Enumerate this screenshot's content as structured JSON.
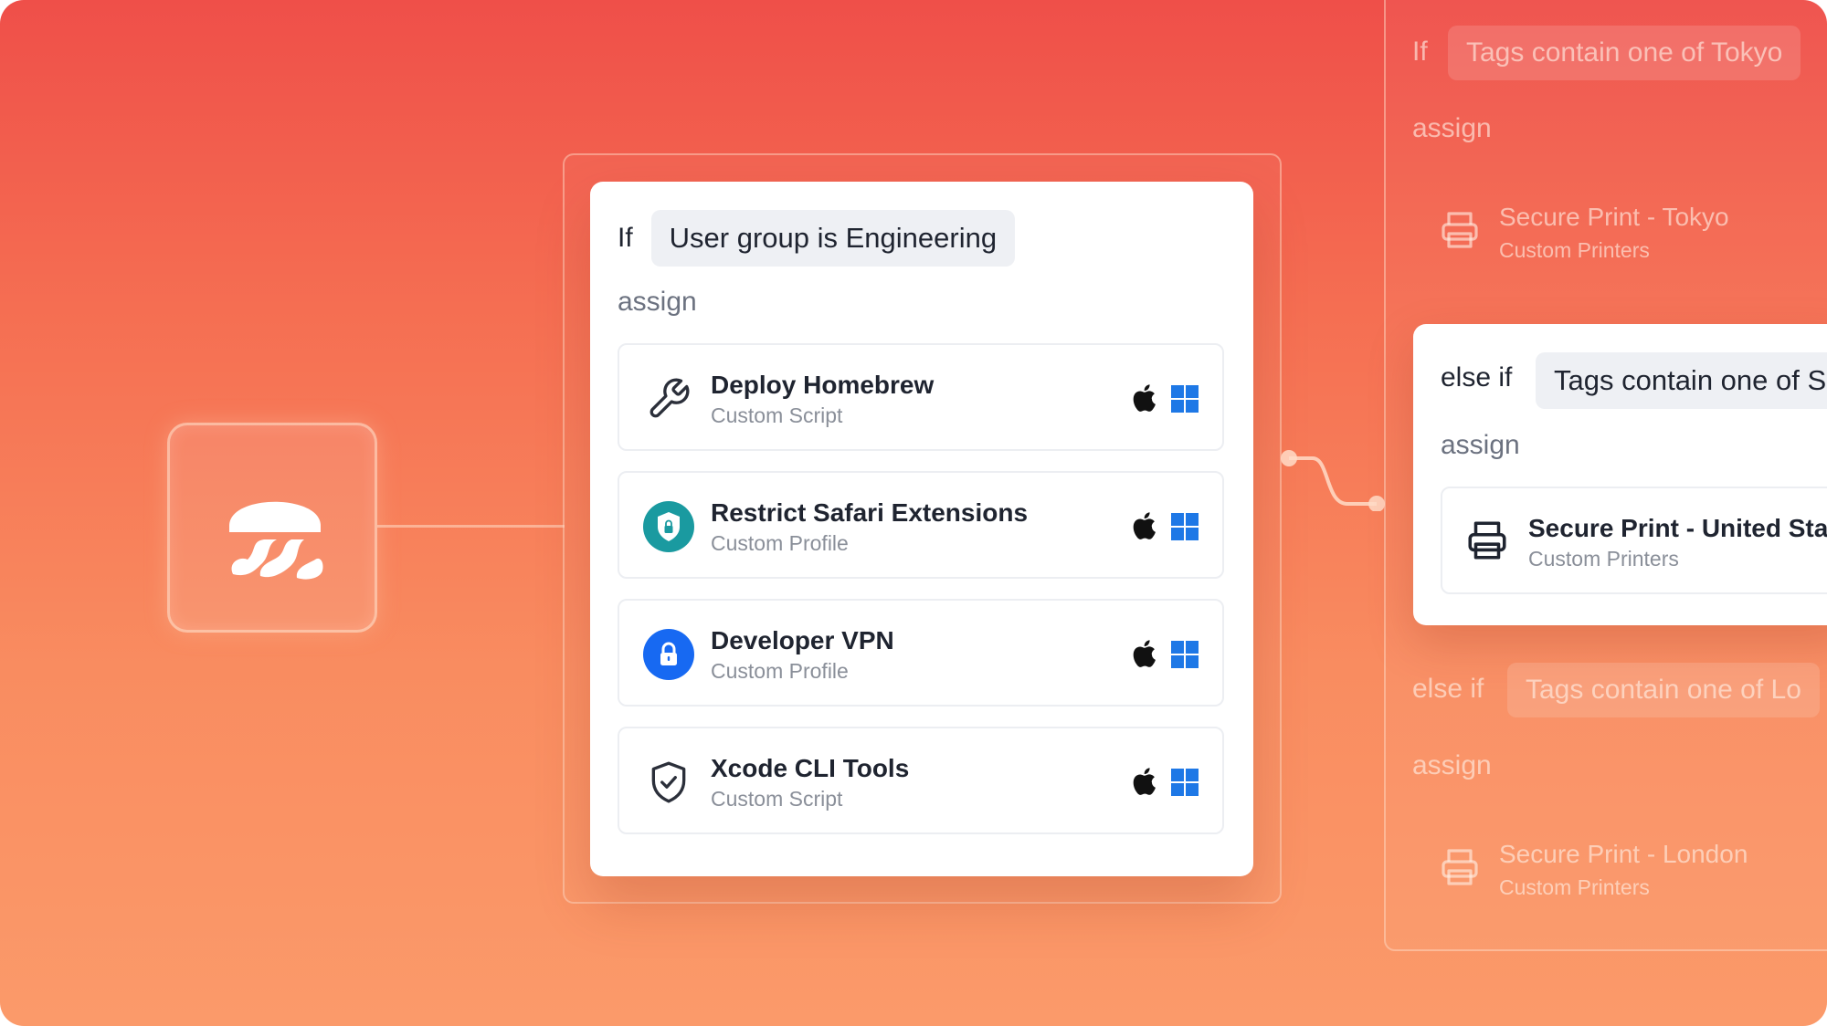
{
  "left_logo": {
    "icon": "jellyfish-logo-icon"
  },
  "main_rule": {
    "if_keyword": "If",
    "condition": "User group is Engineering",
    "assign_label": "assign",
    "items": [
      {
        "title": "Deploy Homebrew",
        "subtitle": "Custom Script",
        "icon": "wrench-icon",
        "platforms": [
          "apple",
          "windows"
        ]
      },
      {
        "title": "Restrict Safari Extensions",
        "subtitle": "Custom Profile",
        "icon": "shield-lock-icon",
        "icon_color": "#1a9aa0",
        "platforms": [
          "apple",
          "windows"
        ]
      },
      {
        "title": "Developer VPN",
        "subtitle": "Custom Profile",
        "icon": "lock-icon",
        "icon_color": "#1769f2",
        "platforms": [
          "apple",
          "windows"
        ]
      },
      {
        "title": "Xcode CLI Tools",
        "subtitle": "Custom Script",
        "icon": "shield-check-icon",
        "platforms": [
          "apple",
          "windows"
        ]
      }
    ]
  },
  "right_rules": {
    "rule1": {
      "keyword": "If",
      "condition": "Tags contain one of Tokyo",
      "assign_label": "assign",
      "item_title": "Secure Print - Tokyo",
      "item_subtitle": "Custom Printers"
    },
    "rule2": {
      "keyword": "else if",
      "condition": "Tags contain one of S",
      "assign_label": "assign",
      "item_title": "Secure Print - United Stat",
      "item_subtitle": "Custom Printers"
    },
    "rule3": {
      "keyword": "else if",
      "condition": "Tags contain one of Lo",
      "assign_label": "assign",
      "item_title": "Secure Print - London",
      "item_subtitle": "Custom Printers"
    }
  },
  "colors": {
    "bg_top": "#ef4f49",
    "bg_bottom": "#fb9a6a",
    "windows_blue": "#1e78e6",
    "text_dark": "#1f2430"
  }
}
